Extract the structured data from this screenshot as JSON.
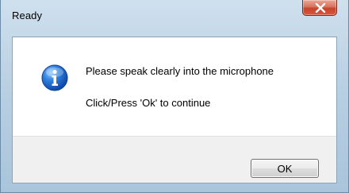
{
  "window": {
    "title": "Ready",
    "close_icon": "close-icon",
    "accent_color": "#c7432b"
  },
  "dialog": {
    "icon": "info-icon",
    "message_line_1": "Please speak clearly into the microphone",
    "message_line_2": "Click/Press 'Ok' to continue",
    "ok_label": "OK"
  }
}
